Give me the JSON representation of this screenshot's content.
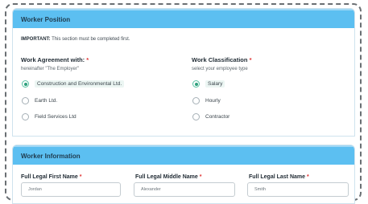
{
  "worker_position": {
    "title": "Worker Position",
    "notice_bold": "IMPORTANT:",
    "notice_text": " This section must be completed first.",
    "agreement": {
      "label": "Work Agreement with:",
      "required": "*",
      "hint": "hereinafter \"The Employer\"",
      "options": [
        "Construction and Environmental Ltd.",
        "Earth Ltd.",
        "Field Services Ltd"
      ],
      "selected_index": 0
    },
    "classification": {
      "label": "Work Classification",
      "required": "*",
      "hint": "select your employee type",
      "options": [
        "Salary",
        "Hourly",
        "Contractor"
      ],
      "selected_index": 0
    }
  },
  "worker_information": {
    "title": "Worker Information",
    "fields": [
      {
        "label": "Full Legal First Name",
        "required": "*",
        "value": "Jordan"
      },
      {
        "label": "Full Legal Middle Name",
        "required": "*",
        "value": "Alexander"
      },
      {
        "label": "Full Legal Last Name",
        "required": "*",
        "value": "Smith"
      }
    ]
  },
  "colors": {
    "header_blue": "#5cbff1",
    "radio_selected": "#2f9f7d",
    "required_red": "#e03030"
  }
}
